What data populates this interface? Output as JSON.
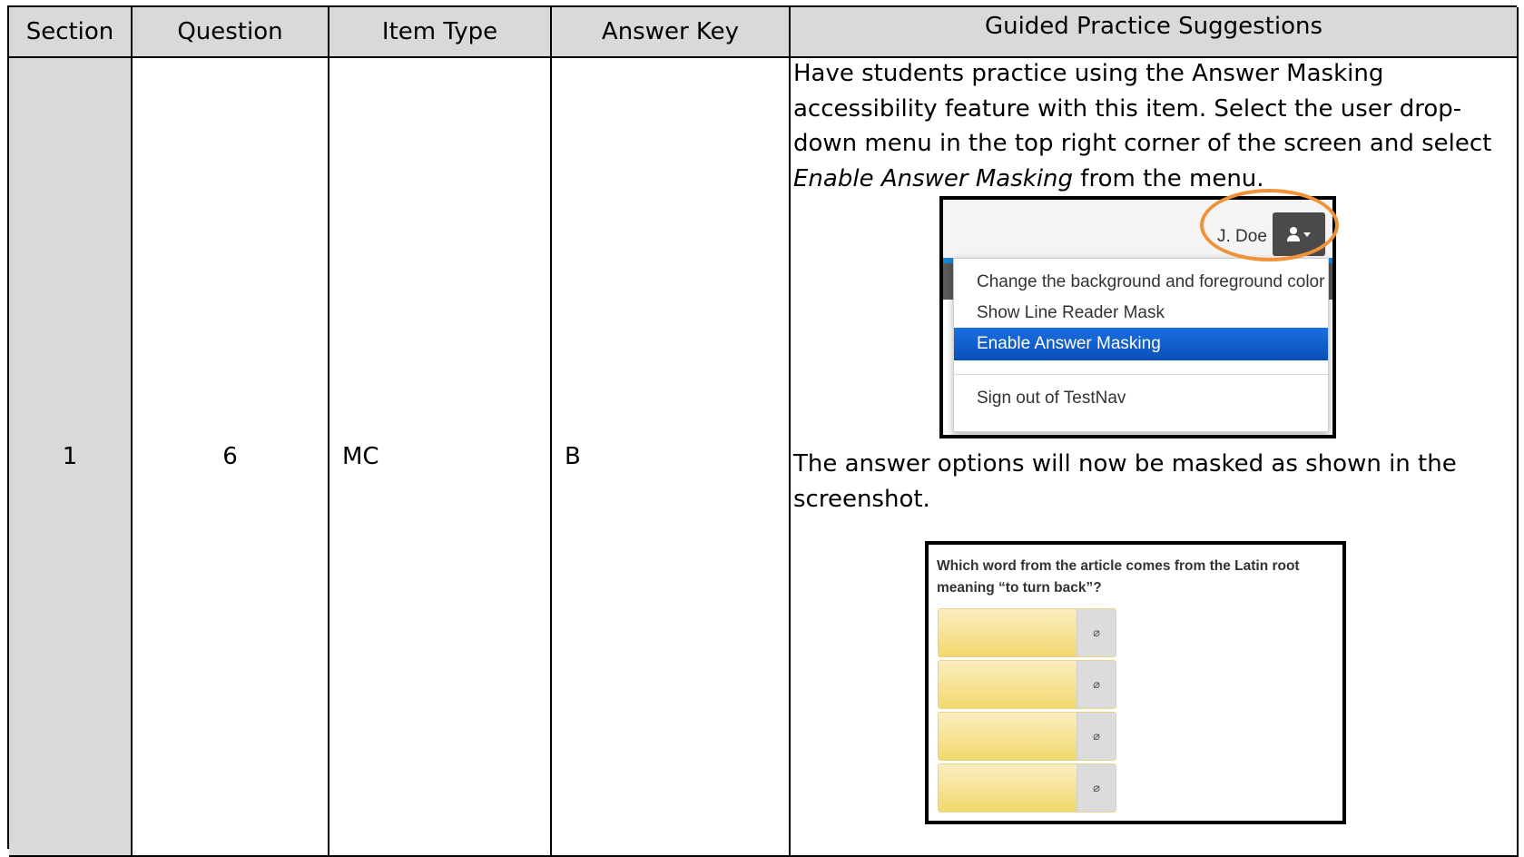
{
  "table": {
    "headers": {
      "section": "Section",
      "question": "Question",
      "item_type": "Item Type",
      "answer_key": "Answer Key",
      "guided_practice": "Guided Practice Suggestions"
    },
    "row": {
      "section": "1",
      "question": "6",
      "item_type": "MC",
      "answer_key": "B"
    }
  },
  "guided_practice": {
    "line1": "Have students practice using the Answer Masking",
    "line2": "accessibility feature with this item. Select the user drop-",
    "line3": "down menu in the top right corner of the screen and select",
    "line4_italic": "Enable Answer Masking",
    "line4_rest": " from the menu.",
    "after_line1": "The answer options will now be masked as shown in the",
    "after_line2": "screenshot."
  },
  "screenshot_menu": {
    "user_name": "J. Doe",
    "items": [
      "Change the background and foreground color",
      "Show Line Reader Mask",
      "Enable Answer Masking",
      "Sign out of TestNav"
    ],
    "selected_item": "Enable Answer Masking",
    "highlight_color": "#f0923a",
    "selected_color": "#1a5fcf",
    "icon": "user-icon"
  },
  "screenshot_question": {
    "question_line1": "Which word from the article comes from the Latin root",
    "question_line2": "meaning “to turn back”?",
    "masked_option_count_icon": "eye-slash-icon",
    "option_color": "#f2d86e"
  }
}
